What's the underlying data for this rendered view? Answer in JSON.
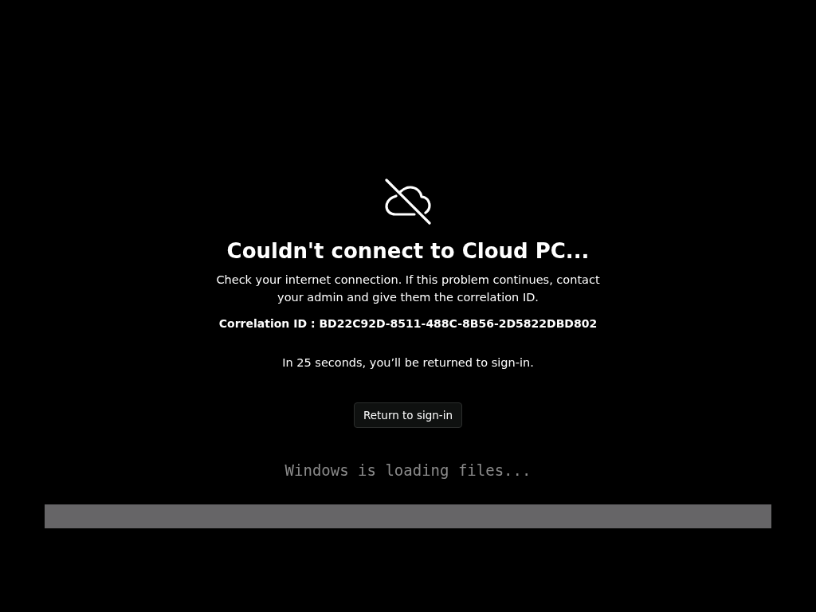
{
  "error": {
    "title": "Couldn't connect to Cloud PC...",
    "message": "Check your internet connection. If this problem continues, contact your admin and give them the correlation ID.",
    "correlation_id": "Correlation ID : BD22C92D-8511-488C-8B56-2D5822DBD802",
    "countdown": "In 25 seconds, you’ll be returned to sign-in.",
    "button": "Return to sign-in"
  },
  "boot": {
    "status": "Windows is loading files..."
  }
}
